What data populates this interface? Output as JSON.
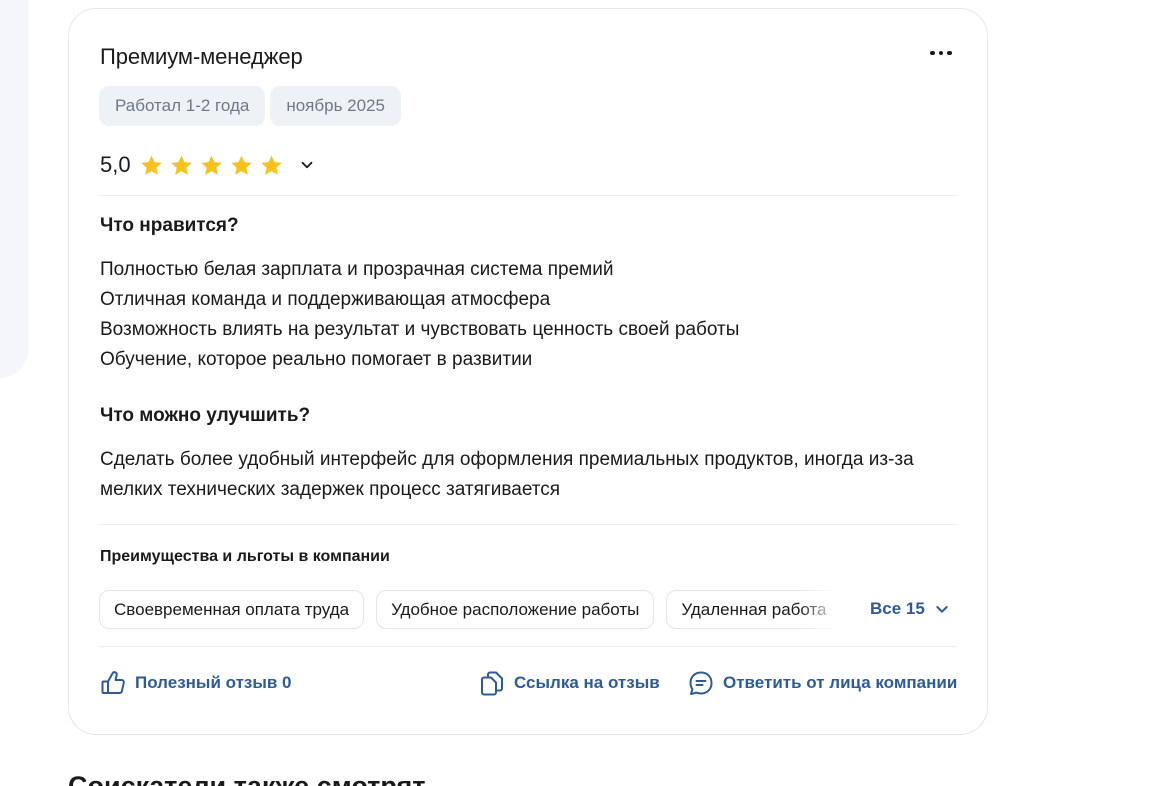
{
  "review": {
    "position": "Премиум-менеджер",
    "tags": [
      "Работал 1-2 года",
      "ноябрь 2025"
    ],
    "rating": "5,0",
    "stars": 5,
    "likes_title": "Что нравится?",
    "likes_lines": [
      "Полностью белая зарплата и прозрачная система премий",
      "Отличная команда и поддерживающая атмосфера",
      "Возможность влиять на результат и чувствовать ценность своей работы",
      "Обучение, которое реально помогает в развитии"
    ],
    "improve_title": "Что можно улучшить?",
    "improve_text": "Сделать более удобный интерфейс для оформления премиальных продуктов, иногда из-за мелких технических задержек процесс затягивается"
  },
  "benefits": {
    "title": "Преимущества и льготы в компании",
    "chips": [
      "Своевременная оплата труда",
      "Удобное расположение работы",
      "Удаленная работа"
    ],
    "all_label": "Все 15"
  },
  "actions": {
    "helpful": "Полезный отзыв 0",
    "link": "Ссылка на отзыв",
    "reply": "Ответить от лица компании"
  },
  "footer": {
    "heading": "Соискатели также смотрят"
  },
  "colors": {
    "star": "#f7c21b",
    "link": "#2f5a99",
    "tag_bg": "#eef1f6",
    "tag_text": "#6e7888"
  },
  "icons": {
    "more": "more-dots-icon",
    "star": "star-icon",
    "chevron": "chevron-down-icon",
    "like": "thumbs-up-icon",
    "copy": "copy-link-icon",
    "reply": "chat-bubble-icon"
  }
}
